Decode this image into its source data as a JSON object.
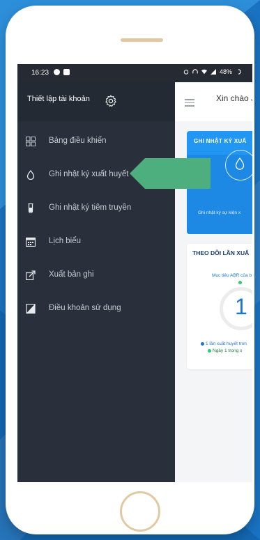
{
  "status": {
    "time": "16:23",
    "battery": "48%"
  },
  "drawer": {
    "title": "Thiết lập tài khoản",
    "items": [
      {
        "label": "Bảng điều khiển",
        "icon": "dashboard-icon"
      },
      {
        "label": "Ghi nhật ký xuất huyết",
        "icon": "drop-icon"
      },
      {
        "label": "Ghi nhật ký tiêm truyền",
        "icon": "vial-icon"
      },
      {
        "label": "Lịch biểu",
        "icon": "calendar-icon"
      },
      {
        "label": "Xuất bản ghi",
        "icon": "export-icon"
      },
      {
        "label": "Điều khoản sử dụng",
        "icon": "document-icon"
      }
    ]
  },
  "main": {
    "greeting": "Xin chào J",
    "card1": {
      "title": "GHI NHẬT KÝ XUẤ",
      "subtitle": "Ghi nhật ký sự kiện x"
    },
    "card2": {
      "title": "THEO DÕI LẦN XUẤ",
      "subtitle": "Mục tiêu ABR của b",
      "value": "1",
      "legend1": "1 lần xuất huyết tron",
      "legend2": "Ngày 1 trong s"
    }
  },
  "colors": {
    "accent": "#2196f3",
    "drawer": "#2a303b",
    "arrow": "#4caf7d",
    "legend_blue": "#1976d2",
    "legend_green": "#2ecc71"
  }
}
